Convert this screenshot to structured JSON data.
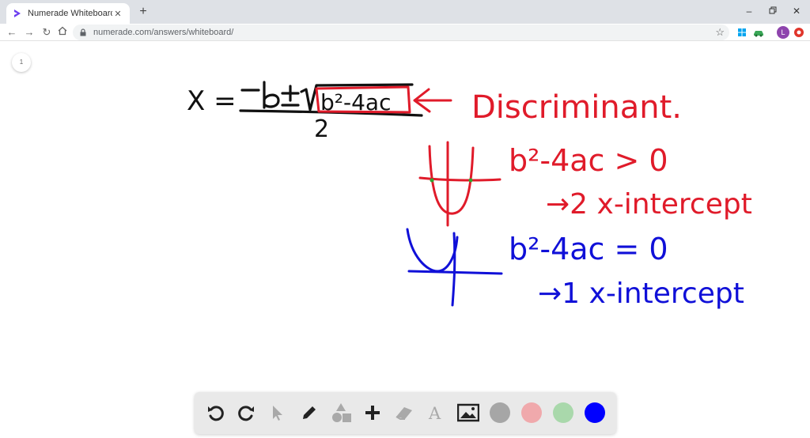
{
  "browser": {
    "tab_title": "Numerade Whiteboard",
    "url": "numerade.com/answers/whiteboard/",
    "profile_initial": "L"
  },
  "whiteboard": {
    "page_number": "1",
    "formula": {
      "lhs": "X =",
      "numerator": "-b ± √",
      "radicand": "b²-4ac",
      "denominator": "2"
    },
    "discriminant_label": "Discriminant.",
    "case_positive": {
      "condition": "b²-4ac > 0",
      "result": "→2 x-intercept"
    },
    "case_zero": {
      "condition": "b²-4ac = 0",
      "result": "→1 x-intercept"
    }
  },
  "colors": {
    "ink_black": "#111111",
    "ink_red": "#e01b2a",
    "ink_blue": "#1010d8",
    "ink_green": "#2fa62f",
    "swatch_gray": "#a6a6a6",
    "swatch_pink": "#f0a9ac",
    "swatch_green": "#a9d8ab",
    "swatch_blue": "#0000ff"
  },
  "tools": [
    "undo-icon",
    "redo-icon",
    "pointer-icon",
    "pen-icon",
    "shapes-icon",
    "add-icon",
    "eraser-icon",
    "text-icon",
    "image-icon"
  ]
}
